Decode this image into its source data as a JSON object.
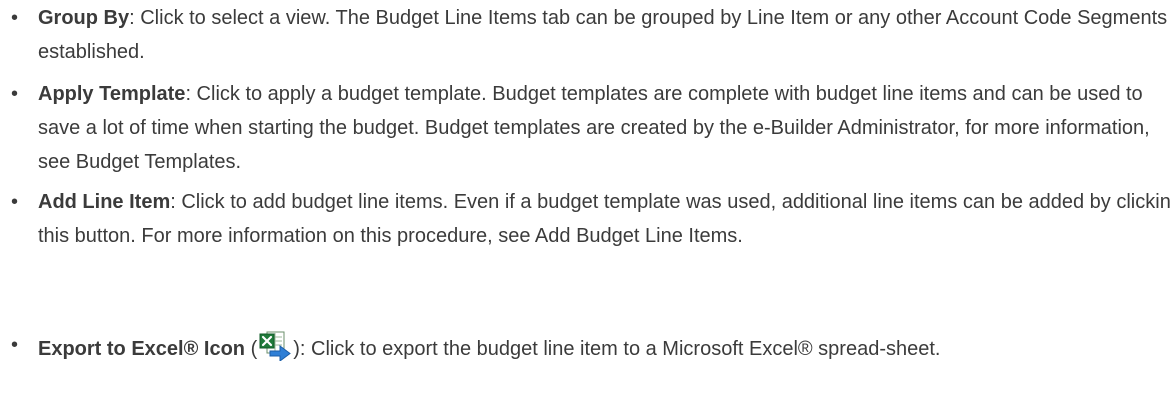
{
  "items": [
    {
      "term": "Group By",
      "text": ":  Click to select a view. The Budget Line Items tab can be grouped by Line Item or any other Account Code Segments established."
    },
    {
      "term": "Apply Template",
      "text": ": Click to apply a budget template. Budget templates are complete with budget line items and can be used to save a lot of time when starting the budget. Budget templates are created by the e-Builder Administrator, for more information, see Budget Templates."
    },
    {
      "term": "Add Line Item",
      "text": ": Click to add budget line items. Even if a budget template was used, additional line items can be added by clicking this button. For more information on this procedure, see Add Budget Line Items."
    },
    {
      "term": "Export to Excel® Icon",
      "text_before": " (",
      "icon": "excel-export-icon",
      "text_after": "): Click to export the budget line item to a Microsoft Excel® spread-sheet."
    }
  ],
  "colors": {
    "text": "#3b3b3b",
    "excel_green": "#1f7a3a",
    "arrow_blue": "#2f7fd6"
  }
}
